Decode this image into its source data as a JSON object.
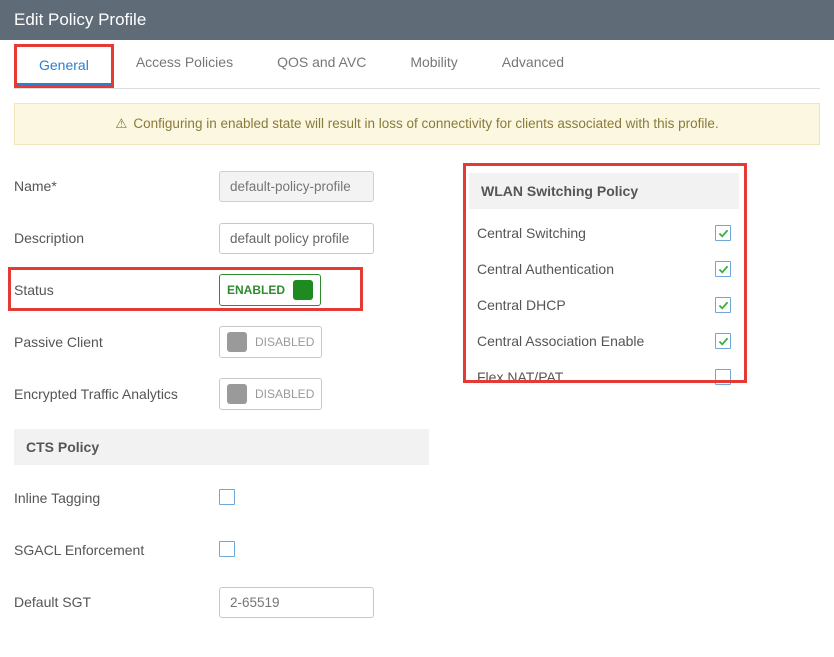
{
  "header": {
    "title": "Edit Policy Profile"
  },
  "tabs": [
    "General",
    "Access Policies",
    "QOS and AVC",
    "Mobility",
    "Advanced"
  ],
  "alert": "Configuring in enabled state will result in loss of connectivity for clients associated with this profile.",
  "left": {
    "name_label": "Name*",
    "name_value": "default-policy-profile",
    "desc_label": "Description",
    "desc_value": "default policy profile",
    "status_label": "Status",
    "status_value": "ENABLED",
    "passive_label": "Passive Client",
    "passive_value": "DISABLED",
    "eta_label": "Encrypted Traffic Analytics",
    "eta_value": "DISABLED",
    "cts_header": "CTS Policy",
    "inline_label": "Inline Tagging",
    "sgacl_label": "SGACL Enforcement",
    "sgt_label": "Default SGT",
    "sgt_placeholder": "2-65519"
  },
  "right": {
    "header": "WLAN Switching Policy",
    "rows": [
      {
        "label": "Central Switching",
        "checked": true
      },
      {
        "label": "Central Authentication",
        "checked": true
      },
      {
        "label": "Central DHCP",
        "checked": true
      },
      {
        "label": "Central Association Enable",
        "checked": true
      },
      {
        "label": "Flex NAT/PAT",
        "checked": false
      }
    ]
  }
}
